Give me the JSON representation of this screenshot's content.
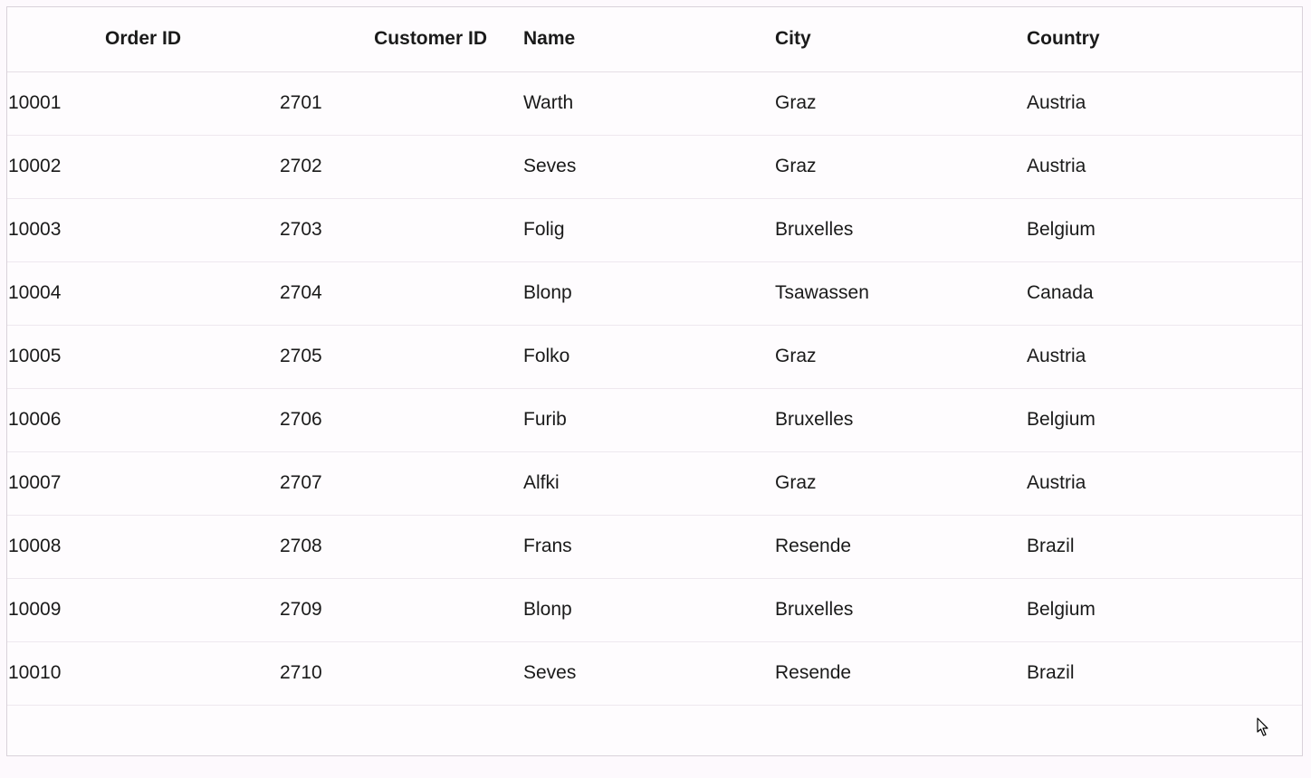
{
  "grid": {
    "headers": {
      "order_id": "Order ID",
      "customer_id": "Customer ID",
      "name": "Name",
      "city": "City",
      "country": "Country"
    },
    "rows": [
      {
        "order_id": "10001",
        "customer_id": "2701",
        "name": "Warth",
        "city": "Graz",
        "country": "Austria"
      },
      {
        "order_id": "10002",
        "customer_id": "2702",
        "name": "Seves",
        "city": "Graz",
        "country": "Austria"
      },
      {
        "order_id": "10003",
        "customer_id": "2703",
        "name": "Folig",
        "city": "Bruxelles",
        "country": "Belgium"
      },
      {
        "order_id": "10004",
        "customer_id": "2704",
        "name": "Blonp",
        "city": "Tsawassen",
        "country": "Canada"
      },
      {
        "order_id": "10005",
        "customer_id": "2705",
        "name": "Folko",
        "city": "Graz",
        "country": "Austria"
      },
      {
        "order_id": "10006",
        "customer_id": "2706",
        "name": "Furib",
        "city": "Bruxelles",
        "country": "Belgium"
      },
      {
        "order_id": "10007",
        "customer_id": "2707",
        "name": "Alfki",
        "city": "Graz",
        "country": "Austria"
      },
      {
        "order_id": "10008",
        "customer_id": "2708",
        "name": "Frans",
        "city": "Resende",
        "country": "Brazil"
      },
      {
        "order_id": "10009",
        "customer_id": "2709",
        "name": "Blonp",
        "city": "Bruxelles",
        "country": "Belgium"
      },
      {
        "order_id": "10010",
        "customer_id": "2710",
        "name": "Seves",
        "city": "Resende",
        "country": "Brazil"
      }
    ]
  }
}
